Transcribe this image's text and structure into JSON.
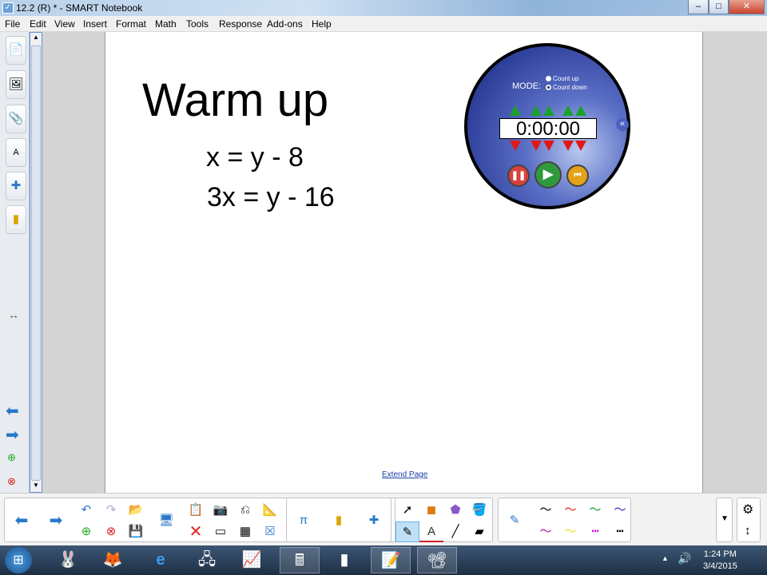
{
  "window": {
    "title": "12.2 (R) * - SMART Notebook",
    "minimize": "‒",
    "maximize": "□",
    "close": "✕"
  },
  "menu": [
    "File",
    "Edit",
    "View",
    "Insert",
    "Format",
    "Math",
    "Tools",
    "Response",
    "Add-ons",
    "Help"
  ],
  "page": {
    "title": "Warm up",
    "equations": [
      "x = y - 8",
      "3x = y - 16"
    ],
    "extend_link": "Extend Page"
  },
  "timer": {
    "mode_label": "MODE:",
    "options": [
      "Count up",
      "Count down"
    ],
    "selected": "Count down",
    "display": "0:00:00"
  },
  "taskbar": {
    "time": "1:24 PM",
    "date": "3/4/2015"
  }
}
